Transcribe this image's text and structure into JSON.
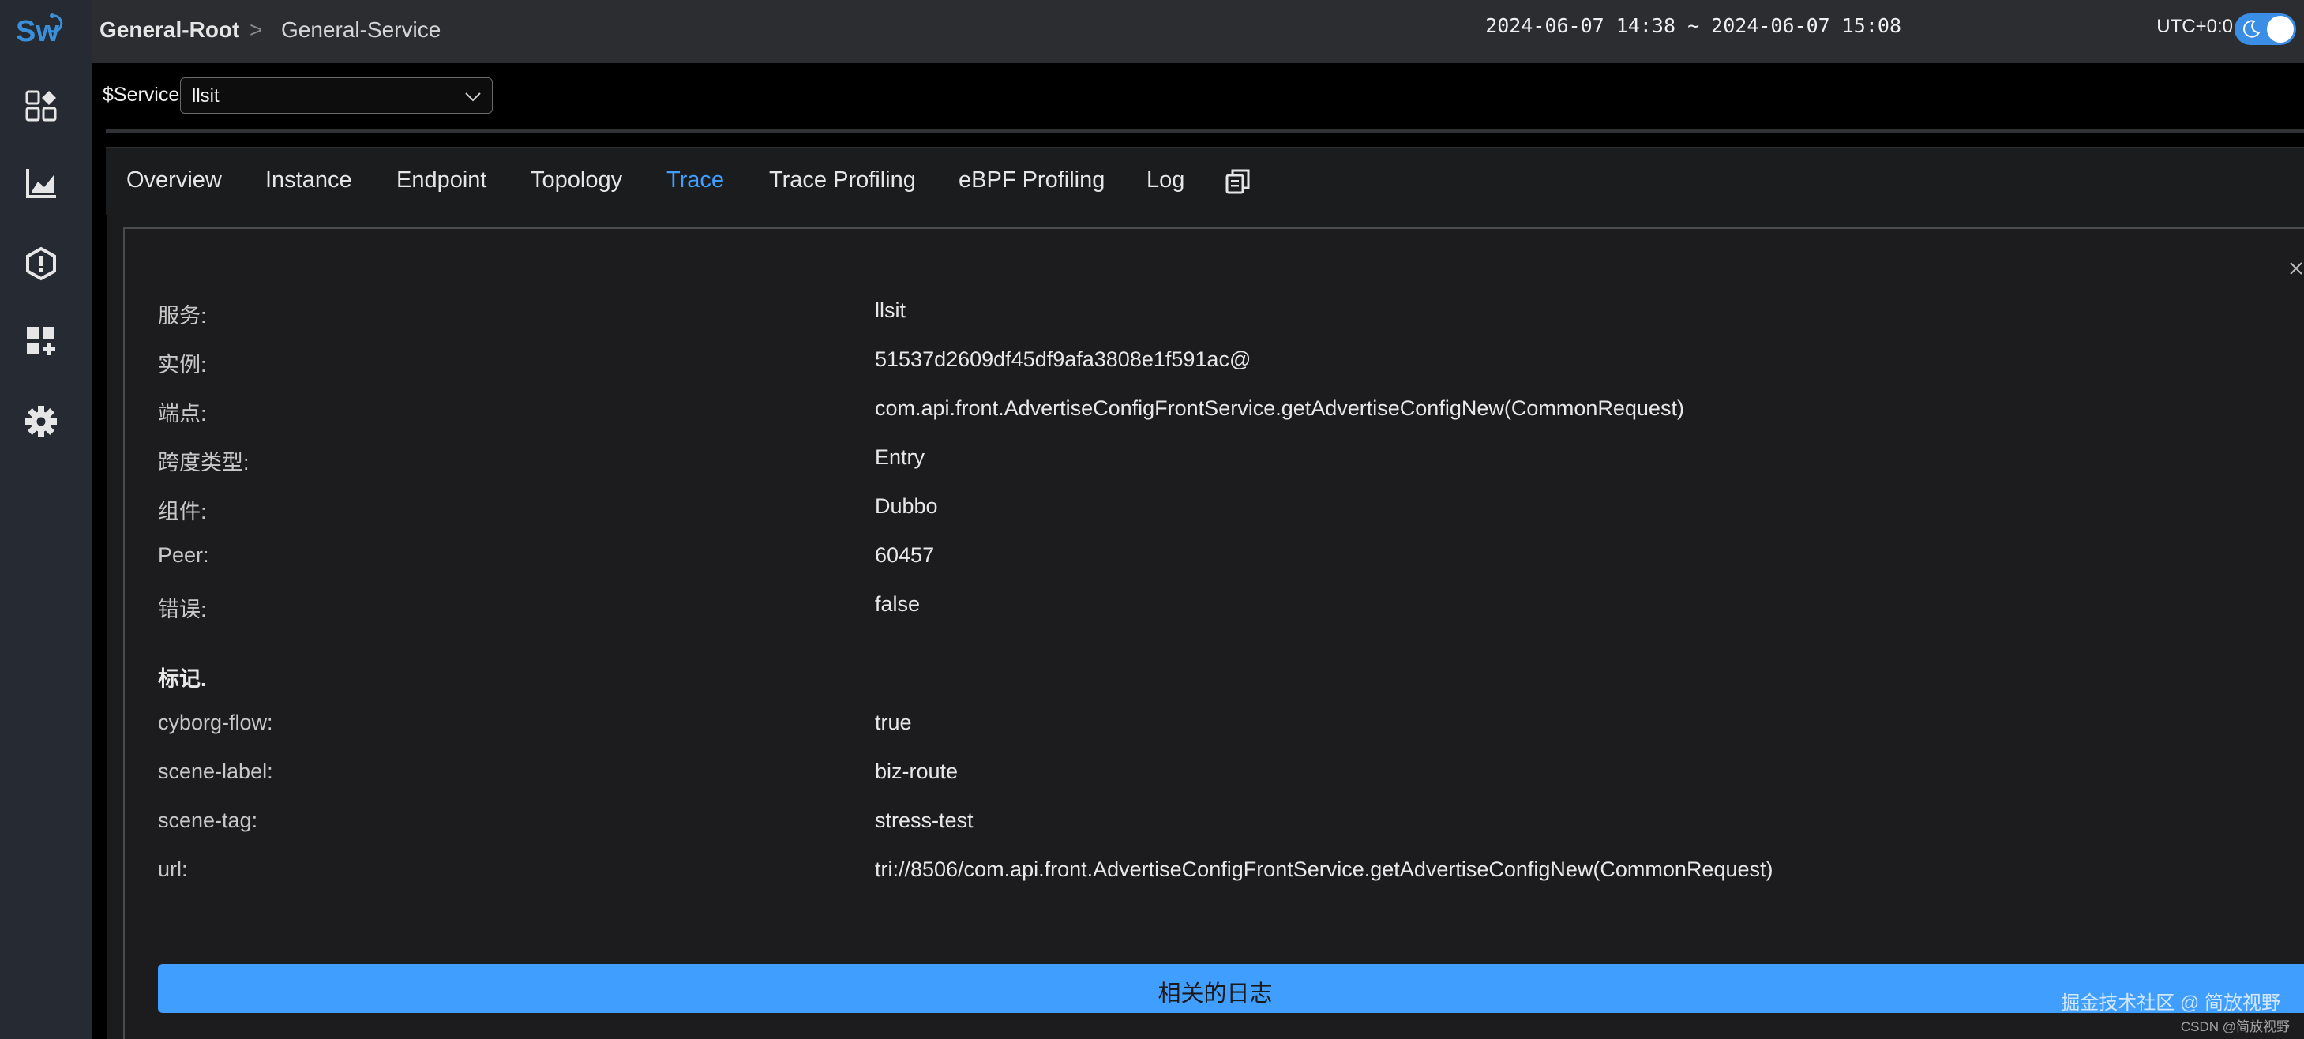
{
  "app": {
    "logo_text": "Sw"
  },
  "header": {
    "breadcrumb_root": "General-Root",
    "breadcrumb_separator": ">",
    "breadcrumb_service": "General-Service",
    "time_range": "2024-06-07 14:38 ~ 2024-06-07 15:08",
    "timezone": "UTC+0:0"
  },
  "sidebar": {
    "items": [
      {
        "icon": "dashboard-icon"
      },
      {
        "icon": "chart-icon"
      },
      {
        "icon": "alert-icon"
      },
      {
        "icon": "widget-add-icon"
      },
      {
        "icon": "settings-gear-icon"
      }
    ]
  },
  "service_selector": {
    "label": "$Service",
    "value": "llsit"
  },
  "tabs": [
    {
      "label": "Overview"
    },
    {
      "label": "Instance"
    },
    {
      "label": "Endpoint"
    },
    {
      "label": "Topology"
    },
    {
      "label": "Trace",
      "active": true
    },
    {
      "label": "Trace Profiling"
    },
    {
      "label": "eBPF Profiling"
    },
    {
      "label": "Log"
    }
  ],
  "span_detail": {
    "rows": [
      {
        "label": "服务:",
        "value": "llsit"
      },
      {
        "label": "实例:",
        "value": "51537d2609df45df9afa3808e1f591ac@"
      },
      {
        "label": "端点:",
        "value": "com.api.front.AdvertiseConfigFrontService.getAdvertiseConfigNew(CommonRequest)"
      },
      {
        "label": "跨度类型:",
        "value": "Entry"
      },
      {
        "label": "组件:",
        "value": "Dubbo"
      },
      {
        "label": "Peer:",
        "value": "60457"
      },
      {
        "label": "错误:",
        "value": "false"
      }
    ],
    "tags_title": "标记.",
    "tags": [
      {
        "label": "cyborg-flow:",
        "value": "true"
      },
      {
        "label": "scene-label:",
        "value": "biz-route"
      },
      {
        "label": "scene-tag:",
        "value": "stress-test"
      },
      {
        "label": "url:",
        "value": "tri://8506/com.api.front.AdvertiseConfigFrontService.getAdvertiseConfigNew(CommonRequest)"
      }
    ],
    "related_logs_button": "相关的日志"
  },
  "watermark": {
    "main": "掘金技术社区 @ 简放视野",
    "small": "CSDN @简放视野"
  },
  "colors": {
    "accent": "#409eff",
    "sidebar_bg": "#252a33",
    "header_bg": "#2b2d31",
    "panel_bg": "#1c1c1e"
  }
}
